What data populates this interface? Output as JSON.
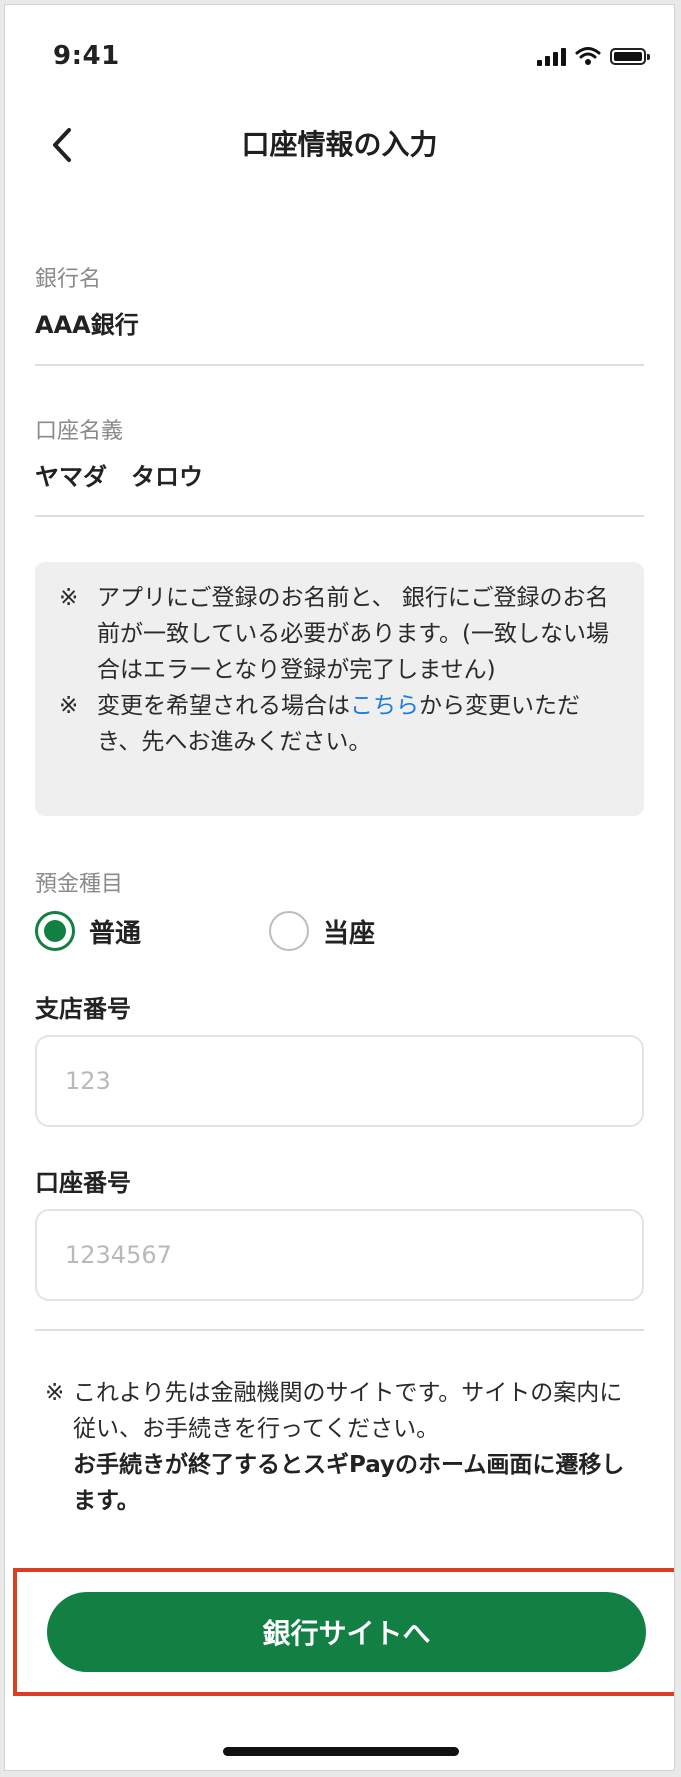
{
  "status_bar": {
    "time": "9:41"
  },
  "header": {
    "title": "口座情報の入力"
  },
  "bank": {
    "label": "銀行名",
    "value": "AAA銀行"
  },
  "account_holder": {
    "label": "口座名義",
    "value": "ヤマダ　タロウ"
  },
  "notice": {
    "mark": "※",
    "line1": "アプリにご登録のお名前と、 銀行にご登録のお名前が一致している必要があります。(一致しない場合はエラーとなり登録が完了しません)",
    "line2_before": "変更を希望される場合は",
    "line2_link": "こちら",
    "line2_after": "から変更いただき、先へお進みください。"
  },
  "deposit_type": {
    "label": "預金種目",
    "options": [
      "普通",
      "当座"
    ],
    "selected": "普通"
  },
  "branch": {
    "label": "支店番号",
    "placeholder": "123"
  },
  "account_number": {
    "label": "口座番号",
    "placeholder": "1234567"
  },
  "footnote": {
    "mark": "※",
    "text": "これより先は金融機関のサイトです。サイトの案内に従い、お手続きを行ってください。",
    "bold": "お手続きが終了するとスギPayのホーム画面に遷移します。"
  },
  "cta": {
    "label": "銀行サイトへ"
  },
  "colors": {
    "brand_green": "#127f43",
    "link_blue": "#1a7de0",
    "highlight_red": "#d93f23"
  }
}
